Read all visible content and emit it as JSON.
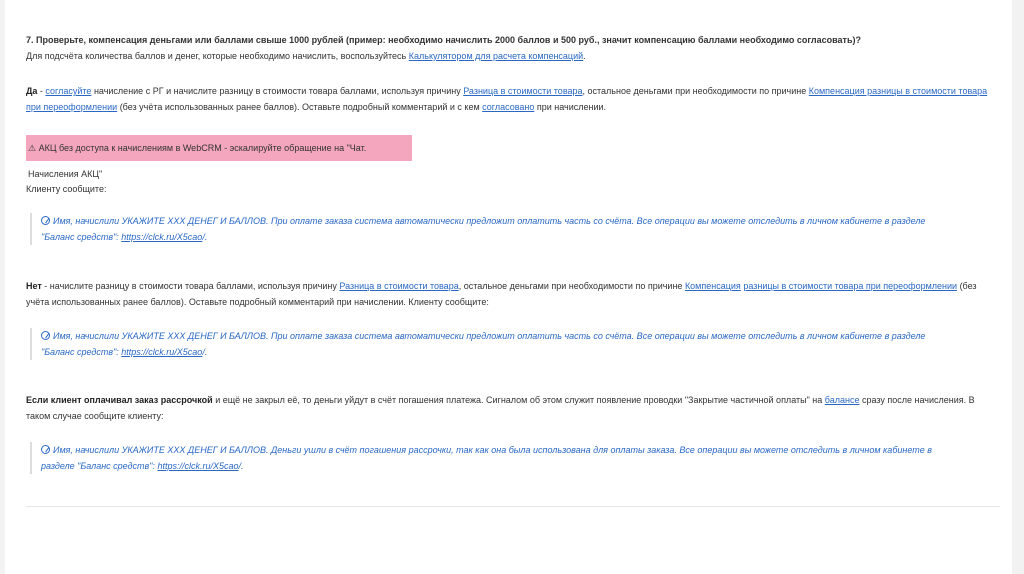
{
  "question": {
    "title": "7. Проверьте, компенсация деньгами или баллами свыше 1000 рублей (пример: необходимо начислить 2000 баллов и 500 руб., значит компенсацию баллами необходимо согласовать)?",
    "calc_prefix": "Для подсчёта количества баллов и денег, которые необходимо начислить, воспользуйтесь",
    "calc_link": "Калькулятором для расчета компенсаций",
    "calc_suffix": "."
  },
  "yes_section": {
    "label": "Да",
    "dash": " - ",
    "agree_link": "согласуйте",
    "text1": " начисление с РГ и начислите разницу в стоимости товара баллами, используя причину ",
    "reason_link": "Разница в стоимости товара",
    "text2": ", остальное деньгами при необходимости по причине ",
    "compensation_link": "Компенсация разницы в стоимости товара при переоформлении",
    "text3": " (без учёта использованных ранее баллов). Оставьте подробный комментарий и с кем ",
    "agreed_link": "согласовано",
    "text4": " при начислении."
  },
  "alert": {
    "icon": "warning-icon",
    "text": "⚠ АКЦ без доступа к начислениям в WebCRM - эскалируйте обращение на \"Чат. Начисления АКЦ\""
  },
  "client_label": "Клиенту сообщите:",
  "quote1": {
    "text": "Имя, начислили УКАЖИТЕ ХХХ ДЕНЕГ И БАЛЛОВ. При оплате заказа система автоматически предложит оплатить часть со счёта. Все операции вы можете отследить в личном кабинете в разделе \"Баланс средств\": ",
    "link": "https://clck.ru/X5cao",
    "end": "/."
  },
  "no_section": {
    "label": "Нет",
    "text1": " - начислите разницу в стоимости товара баллами, используя причину ",
    "reason_link": "Разница в стоимости товара",
    "text2": ", остальное деньгами при необходимости по причине ",
    "comp_link_a": "Компенсация",
    "comp_link_b": "разницы в стоимости товара при переоформлении",
    "text3": " (без учёта использованных ранее баллов). Оставьте подробный комментарий при начислении. Клиенту сообщите:"
  },
  "quote2": {
    "text": "Имя, начислили УКАЖИТЕ ХХХ ДЕНЕГ И БАЛЛОВ. При оплате заказа система автоматически предложит оплатить часть со счёта. Все операции вы можете отследить в личном кабинете в разделе \"Баланс средств\": ",
    "link": "https://clck.ru/X5cao",
    "end": "/."
  },
  "installment_section": {
    "label": "Если клиент оплачивал заказ рассрочкой",
    "text1": " и ещё не закрыл её, то деньги уйдут в счёт погашения платежа. Сигналом об этом служит появление проводки \"Закрытие частичной оплаты\" на ",
    "balance_link": "балансе",
    "text2": " сразу после начисления. В таком случае сообщите клиенту:"
  },
  "quote3": {
    "text": "Имя, начислили УКАЖИТЕ ХХХ ДЕНЕГ И БАЛЛОВ. Деньги ушли в счёт погашения рассрочки, так как она была использована для оплаты заказа. Все операции вы можете отследить в личном кабинете в разделе \"Баланс средств\": ",
    "link": "https://clck.ru/X5cao",
    "end": "/."
  }
}
